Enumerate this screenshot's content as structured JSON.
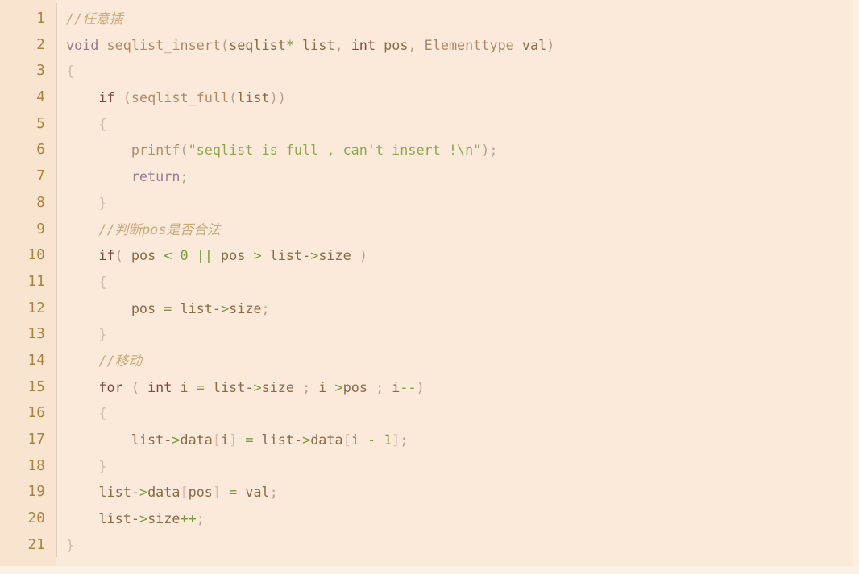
{
  "editor": {
    "kind": "code-listing",
    "language": "C",
    "line_count": 21,
    "colors": {
      "background": "#fbeada",
      "gutter_background": "#f9e5cf",
      "gutter_text": "#a9823f",
      "divider": "#d9cfc3",
      "default_text": "#8c6239",
      "comment": "#c8a979",
      "keyword": "#7f4a3d",
      "keyword_alt": "#9b7b8e",
      "function": "#b08968",
      "string": "#8fa84f",
      "number": "#7a9a3c",
      "operator": "#7a9a3c",
      "punctuation": "#b5a08a",
      "bracket": "#dfb6a8",
      "brace": "#cbbda9"
    },
    "line_numbers": [
      "1",
      "2",
      "3",
      "4",
      "5",
      "6",
      "7",
      "8",
      "9",
      "10",
      "11",
      "12",
      "13",
      "14",
      "15",
      "16",
      "17",
      "18",
      "19",
      "20",
      "21"
    ],
    "lines": [
      {
        "n": "1",
        "text": "//任意插"
      },
      {
        "n": "2",
        "text": "void seqlist_insert(seqlist* list, int pos, Elementtype val)"
      },
      {
        "n": "3",
        "text": "{"
      },
      {
        "n": "4",
        "text": "    if (seqlist_full(list))"
      },
      {
        "n": "5",
        "text": "    {"
      },
      {
        "n": "6",
        "text": "        printf(\"seqlist is full , can't insert !\\n\");"
      },
      {
        "n": "7",
        "text": "        return;"
      },
      {
        "n": "8",
        "text": "    }"
      },
      {
        "n": "9",
        "text": "    //判断pos是否合法"
      },
      {
        "n": "10",
        "text": "    if( pos < 0 || pos > list->size )"
      },
      {
        "n": "11",
        "text": "    {"
      },
      {
        "n": "12",
        "text": "        pos = list->size;"
      },
      {
        "n": "13",
        "text": "    }"
      },
      {
        "n": "14",
        "text": "    //移动"
      },
      {
        "n": "15",
        "text": "    for ( int i = list->size ; i >pos ; i--)"
      },
      {
        "n": "16",
        "text": "    {"
      },
      {
        "n": "17",
        "text": "        list->data[i] = list->data[i - 1];"
      },
      {
        "n": "18",
        "text": "    }"
      },
      {
        "n": "19",
        "text": "    list->data[pos] = val;"
      },
      {
        "n": "20",
        "text": "    list->size++;"
      },
      {
        "n": "21",
        "text": "}"
      }
    ],
    "tokens": [
      [
        {
          "t": "//任意插",
          "c": "t-com"
        }
      ],
      [
        {
          "t": "void",
          "c": "t-kw2"
        },
        {
          "t": " ",
          "c": ""
        },
        {
          "t": "seqlist_insert",
          "c": "t-fn"
        },
        {
          "t": "(",
          "c": "t-punc"
        },
        {
          "t": "seqlist",
          "c": "t-id"
        },
        {
          "t": "*",
          "c": "t-op"
        },
        {
          "t": " ",
          "c": ""
        },
        {
          "t": "list",
          "c": "t-id"
        },
        {
          "t": ",",
          "c": "t-punc"
        },
        {
          "t": " ",
          "c": ""
        },
        {
          "t": "int",
          "c": "t-kw"
        },
        {
          "t": " ",
          "c": ""
        },
        {
          "t": "pos",
          "c": "t-id"
        },
        {
          "t": ",",
          "c": "t-punc"
        },
        {
          "t": " ",
          "c": ""
        },
        {
          "t": "Elementtype",
          "c": "t-type"
        },
        {
          "t": " ",
          "c": ""
        },
        {
          "t": "val",
          "c": "t-id"
        },
        {
          "t": ")",
          "c": "t-punc"
        }
      ],
      [
        {
          "t": "{",
          "c": "t-brace"
        }
      ],
      [
        {
          "t": "    ",
          "c": ""
        },
        {
          "t": "if",
          "c": "t-kw"
        },
        {
          "t": " ",
          "c": ""
        },
        {
          "t": "(",
          "c": "t-punc"
        },
        {
          "t": "seqlist_full",
          "c": "t-fn"
        },
        {
          "t": "(",
          "c": "t-punc"
        },
        {
          "t": "list",
          "c": "t-id"
        },
        {
          "t": ")",
          "c": "t-punc"
        },
        {
          "t": ")",
          "c": "t-punc"
        }
      ],
      [
        {
          "t": "    ",
          "c": ""
        },
        {
          "t": "{",
          "c": "t-brace"
        }
      ],
      [
        {
          "t": "        ",
          "c": ""
        },
        {
          "t": "printf",
          "c": "t-fn"
        },
        {
          "t": "(",
          "c": "t-punc"
        },
        {
          "t": "\"seqlist is full , can't insert !\\n\"",
          "c": "t-str"
        },
        {
          "t": ")",
          "c": "t-punc"
        },
        {
          "t": ";",
          "c": "t-punc"
        }
      ],
      [
        {
          "t": "        ",
          "c": ""
        },
        {
          "t": "return",
          "c": "t-kw2"
        },
        {
          "t": ";",
          "c": "t-punc"
        }
      ],
      [
        {
          "t": "    ",
          "c": ""
        },
        {
          "t": "}",
          "c": "t-brace"
        }
      ],
      [
        {
          "t": "    ",
          "c": ""
        },
        {
          "t": "//判断pos是否合法",
          "c": "t-com"
        }
      ],
      [
        {
          "t": "    ",
          "c": ""
        },
        {
          "t": "if",
          "c": "t-kw"
        },
        {
          "t": "(",
          "c": "t-punc"
        },
        {
          "t": " ",
          "c": ""
        },
        {
          "t": "pos",
          "c": "t-id"
        },
        {
          "t": " ",
          "c": ""
        },
        {
          "t": "<",
          "c": "t-op"
        },
        {
          "t": " ",
          "c": ""
        },
        {
          "t": "0",
          "c": "t-num"
        },
        {
          "t": " ",
          "c": ""
        },
        {
          "t": "||",
          "c": "t-op"
        },
        {
          "t": " ",
          "c": ""
        },
        {
          "t": "pos",
          "c": "t-id"
        },
        {
          "t": " ",
          "c": ""
        },
        {
          "t": ">",
          "c": "t-op"
        },
        {
          "t": " ",
          "c": ""
        },
        {
          "t": "list",
          "c": "t-id"
        },
        {
          "t": "-",
          "c": "t-id"
        },
        {
          "t": ">",
          "c": "t-op"
        },
        {
          "t": "size",
          "c": "t-id"
        },
        {
          "t": " ",
          "c": ""
        },
        {
          "t": ")",
          "c": "t-punc"
        }
      ],
      [
        {
          "t": "    ",
          "c": ""
        },
        {
          "t": "{",
          "c": "t-brace"
        }
      ],
      [
        {
          "t": "        ",
          "c": ""
        },
        {
          "t": "pos",
          "c": "t-id"
        },
        {
          "t": " ",
          "c": ""
        },
        {
          "t": "=",
          "c": "t-op"
        },
        {
          "t": " ",
          "c": ""
        },
        {
          "t": "list",
          "c": "t-id"
        },
        {
          "t": "-",
          "c": "t-id"
        },
        {
          "t": ">",
          "c": "t-op"
        },
        {
          "t": "size",
          "c": "t-id"
        },
        {
          "t": ";",
          "c": "t-punc"
        }
      ],
      [
        {
          "t": "    ",
          "c": ""
        },
        {
          "t": "}",
          "c": "t-brace"
        }
      ],
      [
        {
          "t": "    ",
          "c": ""
        },
        {
          "t": "//移动",
          "c": "t-com"
        }
      ],
      [
        {
          "t": "    ",
          "c": ""
        },
        {
          "t": "for",
          "c": "t-kw"
        },
        {
          "t": " ",
          "c": ""
        },
        {
          "t": "(",
          "c": "t-punc"
        },
        {
          "t": " ",
          "c": ""
        },
        {
          "t": "int",
          "c": "t-kw"
        },
        {
          "t": " ",
          "c": ""
        },
        {
          "t": "i",
          "c": "t-id"
        },
        {
          "t": " ",
          "c": ""
        },
        {
          "t": "=",
          "c": "t-op"
        },
        {
          "t": " ",
          "c": ""
        },
        {
          "t": "list",
          "c": "t-id"
        },
        {
          "t": "-",
          "c": "t-id"
        },
        {
          "t": ">",
          "c": "t-op"
        },
        {
          "t": "size",
          "c": "t-id"
        },
        {
          "t": " ",
          "c": ""
        },
        {
          "t": ";",
          "c": "t-punc"
        },
        {
          "t": " ",
          "c": ""
        },
        {
          "t": "i",
          "c": "t-id"
        },
        {
          "t": " ",
          "c": ""
        },
        {
          "t": ">",
          "c": "t-op"
        },
        {
          "t": "pos",
          "c": "t-id"
        },
        {
          "t": " ",
          "c": ""
        },
        {
          "t": ";",
          "c": "t-punc"
        },
        {
          "t": " ",
          "c": ""
        },
        {
          "t": "i",
          "c": "t-id"
        },
        {
          "t": "--",
          "c": "t-op"
        },
        {
          "t": ")",
          "c": "t-punc"
        }
      ],
      [
        {
          "t": "    ",
          "c": ""
        },
        {
          "t": "{",
          "c": "t-brace"
        }
      ],
      [
        {
          "t": "        ",
          "c": ""
        },
        {
          "t": "list",
          "c": "t-id"
        },
        {
          "t": "-",
          "c": "t-id"
        },
        {
          "t": ">",
          "c": "t-op"
        },
        {
          "t": "data",
          "c": "t-id"
        },
        {
          "t": "[",
          "c": "t-brk"
        },
        {
          "t": "i",
          "c": "t-id"
        },
        {
          "t": "]",
          "c": "t-brk"
        },
        {
          "t": " ",
          "c": ""
        },
        {
          "t": "=",
          "c": "t-op"
        },
        {
          "t": " ",
          "c": ""
        },
        {
          "t": "list",
          "c": "t-id"
        },
        {
          "t": "-",
          "c": "t-id"
        },
        {
          "t": ">",
          "c": "t-op"
        },
        {
          "t": "data",
          "c": "t-id"
        },
        {
          "t": "[",
          "c": "t-brk"
        },
        {
          "t": "i",
          "c": "t-id"
        },
        {
          "t": " ",
          "c": ""
        },
        {
          "t": "-",
          "c": "t-op"
        },
        {
          "t": " ",
          "c": ""
        },
        {
          "t": "1",
          "c": "t-num"
        },
        {
          "t": "]",
          "c": "t-brk"
        },
        {
          "t": ";",
          "c": "t-punc"
        }
      ],
      [
        {
          "t": "    ",
          "c": ""
        },
        {
          "t": "}",
          "c": "t-brace"
        }
      ],
      [
        {
          "t": "    ",
          "c": ""
        },
        {
          "t": "list",
          "c": "t-id"
        },
        {
          "t": "-",
          "c": "t-id"
        },
        {
          "t": ">",
          "c": "t-op"
        },
        {
          "t": "data",
          "c": "t-id"
        },
        {
          "t": "[",
          "c": "t-brk"
        },
        {
          "t": "pos",
          "c": "t-id"
        },
        {
          "t": "]",
          "c": "t-brk"
        },
        {
          "t": " ",
          "c": ""
        },
        {
          "t": "=",
          "c": "t-op"
        },
        {
          "t": " ",
          "c": ""
        },
        {
          "t": "val",
          "c": "t-id"
        },
        {
          "t": ";",
          "c": "t-punc"
        }
      ],
      [
        {
          "t": "    ",
          "c": ""
        },
        {
          "t": "list",
          "c": "t-id"
        },
        {
          "t": "-",
          "c": "t-id"
        },
        {
          "t": ">",
          "c": "t-op"
        },
        {
          "t": "size",
          "c": "t-id"
        },
        {
          "t": "++",
          "c": "t-op"
        },
        {
          "t": ";",
          "c": "t-punc"
        }
      ],
      [
        {
          "t": "}",
          "c": "t-brace"
        }
      ]
    ]
  }
}
